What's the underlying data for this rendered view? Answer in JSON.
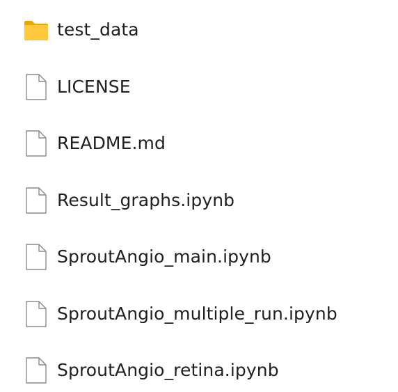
{
  "files": [
    {
      "name": "test_data",
      "icon": "folder-icon"
    },
    {
      "name": "LICENSE",
      "icon": "file-icon"
    },
    {
      "name": "README.md",
      "icon": "file-icon"
    },
    {
      "name": "Result_graphs.ipynb",
      "icon": "file-icon"
    },
    {
      "name": "SproutAngio_main.ipynb",
      "icon": "file-icon"
    },
    {
      "name": "SproutAngio_multiple_run.ipynb",
      "icon": "file-icon"
    },
    {
      "name": "SproutAngio_retina.ipynb",
      "icon": "file-icon"
    }
  ],
  "colors": {
    "folder_back": "#E8A800",
    "folder_front": "#FFC83D",
    "file_outline": "#8a8a8a",
    "file_fill": "#ffffff",
    "text": "#1f1f1f"
  }
}
